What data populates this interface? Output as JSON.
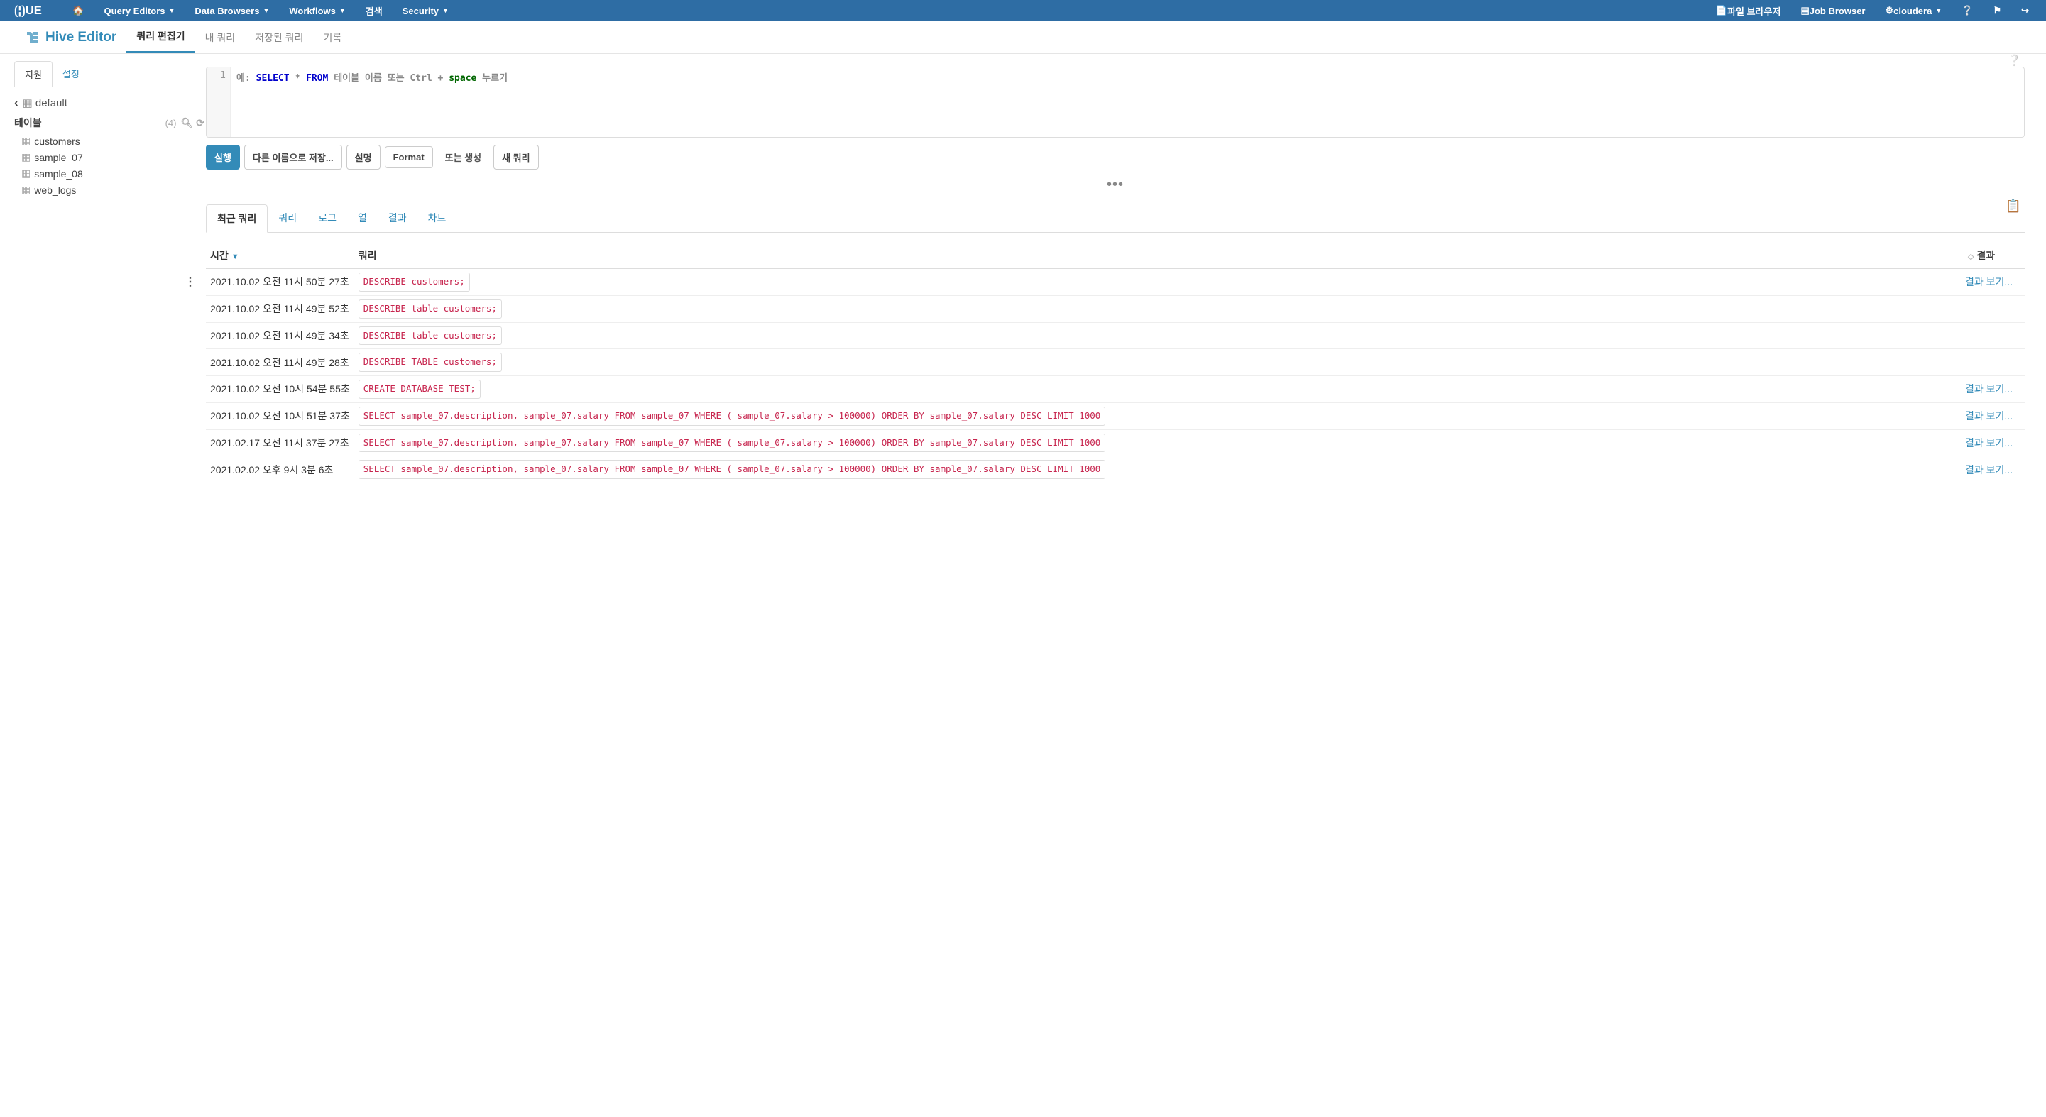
{
  "topnav": {
    "items": [
      "Query Editors",
      "Data Browsers",
      "Workflows",
      "검색",
      "Security"
    ],
    "right": {
      "file_browser": "파일 브라우저",
      "job_browser": "Job Browser",
      "user": "cloudera"
    }
  },
  "subnav": {
    "brand": "Hive Editor",
    "tabs": [
      "쿼리 편집기",
      "내 쿼리",
      "저장된 쿼리",
      "기록"
    ]
  },
  "side": {
    "tabs": [
      "지원",
      "설정"
    ],
    "db": "default",
    "tables_label": "테이블",
    "table_count": "(4)",
    "tables": [
      "customers",
      "sample_07",
      "sample_08",
      "web_logs"
    ]
  },
  "editor": {
    "line": "1",
    "ph_pre": "예: ",
    "ph_select": "SELECT",
    "ph_star": " * ",
    "ph_from": "FROM",
    "ph_mid": " 테이블 이름 또는 Ctrl + ",
    "ph_space": "space",
    "ph_end": " 누르기"
  },
  "buttons": {
    "run": "실행",
    "saveas": "다른 이름으로 저장...",
    "explain": "설명",
    "format": "Format",
    "or": "또는 생성",
    "newq": "새 쿼리"
  },
  "rtabs": [
    "최근 쿼리",
    "쿼리",
    "로그",
    "열",
    "결과",
    "차트"
  ],
  "headers": {
    "time": "시간",
    "query": "쿼리",
    "result": "결과"
  },
  "view_result": "결과 보기...",
  "rows": [
    {
      "time": "2021.10.02 오전 11시 50분 27초",
      "q": "DESCRIBE customers;",
      "res": true,
      "hover": true
    },
    {
      "time": "2021.10.02 오전 11시 49분 52초",
      "q": "DESCRIBE table customers;",
      "res": false
    },
    {
      "time": "2021.10.02 오전 11시 49분 34초",
      "q": "DESCRIBE table customers;",
      "res": false
    },
    {
      "time": "2021.10.02 오전 11시 49분 28초",
      "q": "DESCRIBE TABLE customers;",
      "res": false
    },
    {
      "time": "2021.10.02 오전 10시 54분 55초",
      "q": "CREATE DATABASE TEST;",
      "res": true
    },
    {
      "time": "2021.10.02 오전 10시 51분 37초",
      "q": "SELECT sample_07.description, sample_07.salary FROM sample_07 WHERE ( sample_07.salary > 100000) ORDER BY sample_07.salary DESC LIMIT 1000",
      "res": true
    },
    {
      "time": "2021.02.17 오전 11시 37분 27초",
      "q": "SELECT sample_07.description, sample_07.salary FROM sample_07 WHERE ( sample_07.salary > 100000) ORDER BY sample_07.salary DESC LIMIT 1000",
      "res": true
    },
    {
      "time": "2021.02.02 오후 9시 3분 6초",
      "q": "SELECT sample_07.description, sample_07.salary FROM sample_07 WHERE ( sample_07.salary > 100000) ORDER BY sample_07.salary DESC LIMIT 1000",
      "res": true
    }
  ]
}
